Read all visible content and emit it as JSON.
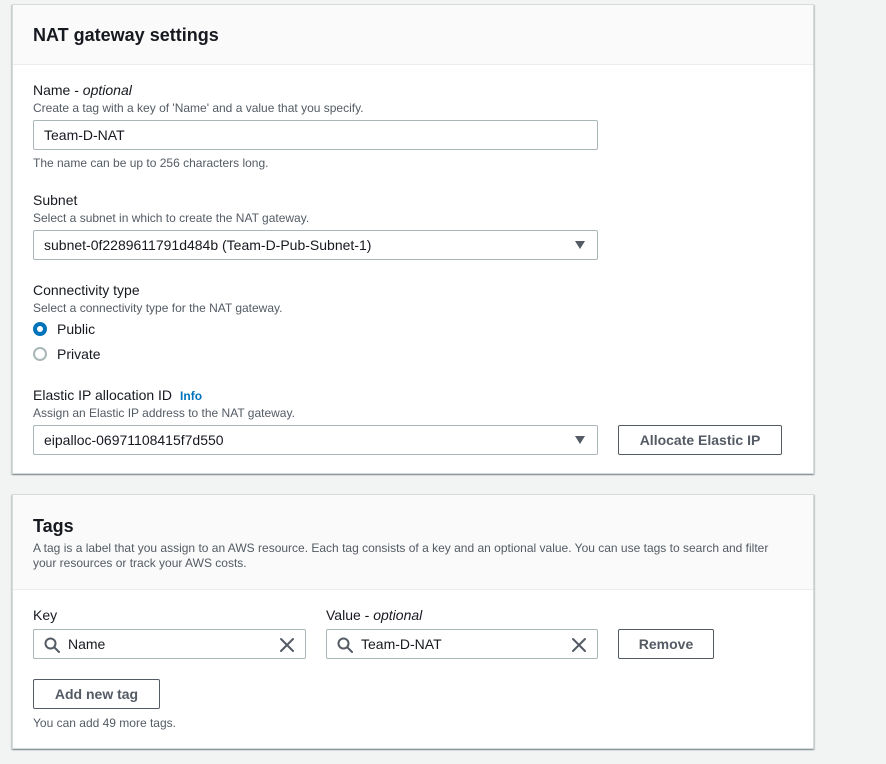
{
  "nat": {
    "title": "NAT gateway settings",
    "name": {
      "label": "Name - ",
      "label_optional": "optional",
      "description": "Create a tag with a key of 'Name' and a value that you specify.",
      "value": "Team-D-NAT",
      "constraint": "The name can be up to 256 characters long."
    },
    "subnet": {
      "label": "Subnet",
      "description": "Select a subnet in which to create the NAT gateway.",
      "selected": "subnet-0f2289611791d484b (Team-D-Pub-Subnet-1)"
    },
    "connectivity": {
      "label": "Connectivity type",
      "description": "Select a connectivity type for the NAT gateway.",
      "options": [
        {
          "label": "Public",
          "checked": true
        },
        {
          "label": "Private",
          "checked": false
        }
      ]
    },
    "eip": {
      "label": "Elastic IP allocation ID",
      "info": "Info",
      "description": "Assign an Elastic IP address to the NAT gateway.",
      "selected": "eipalloc-06971108415f7d550",
      "allocate_button": "Allocate Elastic IP"
    }
  },
  "tags": {
    "title": "Tags",
    "description": "A tag is a label that you assign to an AWS resource. Each tag consists of a key and an optional value. You can use tags to search and filter your resources or track your AWS costs.",
    "key_label": "Key",
    "value_label": "Value - ",
    "value_label_optional": "optional",
    "rows": [
      {
        "key": "Name",
        "value": "Team-D-NAT",
        "remove": "Remove"
      }
    ],
    "add_button": "Add new tag",
    "remaining": "You can add 49 more tags."
  },
  "colors": {
    "accent": "#0073bb",
    "text": "#16191f",
    "muted": "#545b64",
    "border": "#aab7b8"
  }
}
